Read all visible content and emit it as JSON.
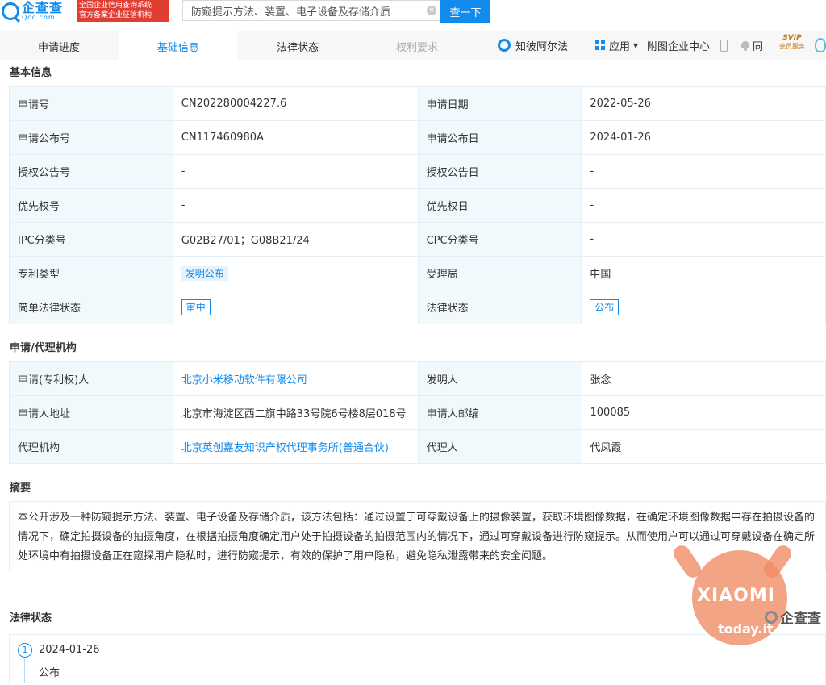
{
  "header": {
    "logo_name": "企查查",
    "logo_domain": "Qcc.com",
    "logo_badge_line1": "全国企业信用查询系统",
    "logo_badge_line2": "官方备案企业征信机构",
    "search_value": "防窥提示方法、装置、电子设备及存储介质",
    "search_button": "查一下"
  },
  "tabs": [
    {
      "label": "申请进度"
    },
    {
      "label": "基础信息"
    },
    {
      "label": "法律状态"
    },
    {
      "label": "权利要求"
    }
  ],
  "toolbar": {
    "zbaf": "知彼阿尔法",
    "apps": "应用",
    "attach_enterprise": "附图企业中心",
    "sync": "同",
    "svip_top": "SVIP",
    "svip_bottom": "会员服务"
  },
  "basic_info": {
    "title": "基本信息",
    "rows": [
      {
        "l1": "申请号",
        "v1": "CN202280004227.6",
        "l2": "申请日期",
        "v2": "2022-05-26"
      },
      {
        "l1": "申请公布号",
        "v1": "CN117460980A",
        "l2": "申请公布日",
        "v2": "2024-01-26"
      },
      {
        "l1": "授权公告号",
        "v1": "-",
        "l2": "授权公告日",
        "v2": "-"
      },
      {
        "l1": "优先权号",
        "v1": "-",
        "l2": "优先权日",
        "v2": "-"
      },
      {
        "l1": "IPC分类号",
        "v1": "G02B27/01；G08B21/24",
        "l2": "CPC分类号",
        "v2": "-"
      },
      {
        "l1": "专利类型",
        "v1": "发明公布",
        "l2": "受理局",
        "v2": "中国"
      },
      {
        "l1": "简单法律状态",
        "v1": "审中",
        "l2": "法律状态",
        "v2": "公布"
      }
    ]
  },
  "agency": {
    "title": "申请/代理机构",
    "rows": [
      {
        "l1": "申请(专利权)人",
        "v1": "北京小米移动软件有限公司",
        "l2": "发明人",
        "v2": "张念"
      },
      {
        "l1": "申请人地址",
        "v1": "北京市海淀区西二旗中路33号院6号楼8层018号",
        "l2": "申请人邮编",
        "v2": "100085"
      },
      {
        "l1": "代理机构",
        "v1": "北京英创嘉友知识产权代理事务所(普通合伙)",
        "l2": "代理人",
        "v2": "代凤霞"
      }
    ]
  },
  "abstract": {
    "title": "摘要",
    "text": "本公开涉及一种防窥提示方法、装置、电子设备及存储介质，该方法包括：通过设置于可穿戴设备上的摄像装置，获取环境图像数据，在确定环境图像数据中存在拍摄设备的情况下，确定拍摄设备的拍摄角度，在根据拍摄角度确定用户处于拍摄设备的拍摄范围内的情况下，通过可穿戴设备进行防窥提示。从而使用户可以通过可穿戴设备在确定所处环境中有拍摄设备正在窥探用户隐私时，进行防窥提示，有效的保护了用户隐私，避免隐私泄露带来的安全问题。"
  },
  "legal_status": {
    "title": "法律状态",
    "events": [
      {
        "index": "1",
        "date": "2024-01-26",
        "status": "公布"
      }
    ]
  },
  "watermark": {
    "brand": "XIAOMI",
    "site": "today.it",
    "qcc": "企查查"
  },
  "colors": {
    "accent": "#128bed",
    "label_bg": "#f2f9fc",
    "badge_red": "#e13d33",
    "watermark": "#f08a62"
  }
}
